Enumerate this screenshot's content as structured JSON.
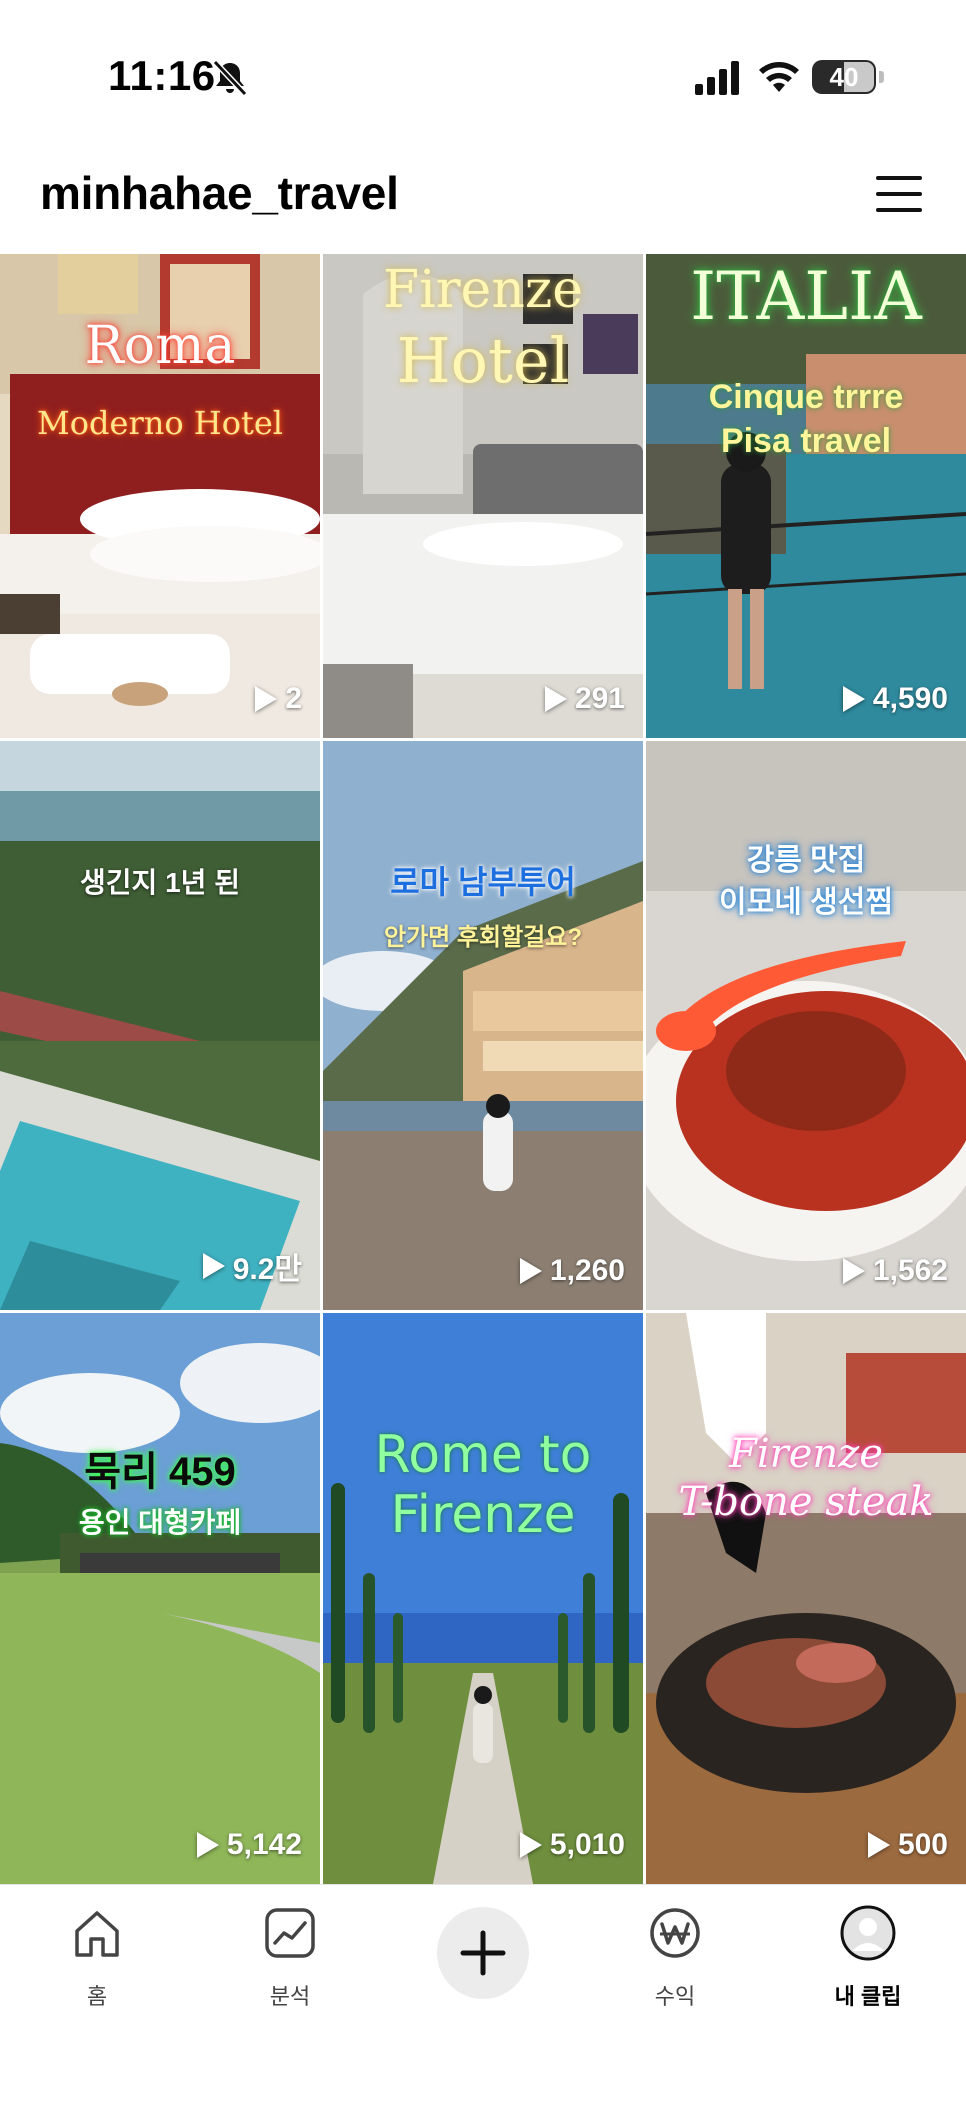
{
  "status_bar": {
    "time": "11:16",
    "battery": "40"
  },
  "header": {
    "profile_name": "minhahae_travel"
  },
  "clips": [
    {
      "title_lines": [
        "Roma",
        "Moderno Hotel"
      ],
      "plays": "2"
    },
    {
      "title_lines": [
        "Firenze",
        "Hotel"
      ],
      "plays": "291"
    },
    {
      "title_lines": [
        "ITALIA",
        "Cinque trrre",
        "Pisa travel"
      ],
      "plays": "4,590"
    },
    {
      "title_lines": [
        "생긴지 1년 된"
      ],
      "plays": "9.2만"
    },
    {
      "title_lines": [
        "로마 남부투어",
        "안가면 후회할걸요?"
      ],
      "plays": "1,260"
    },
    {
      "title_lines": [
        "강릉 맛집",
        "이모네 생선찜"
      ],
      "plays": "1,562"
    },
    {
      "title_lines": [
        "묵리 459",
        "용인 대형카페"
      ],
      "plays": "5,142"
    },
    {
      "title_lines": [
        "Rome to",
        "Firenze"
      ],
      "plays": "5,010"
    },
    {
      "title_lines": [
        "Firenze",
        "T-bone steak"
      ],
      "plays": "500"
    }
  ],
  "nav": {
    "home": "홈",
    "analytics": "분석",
    "earnings": "수익",
    "my_clips": "내 클립"
  }
}
